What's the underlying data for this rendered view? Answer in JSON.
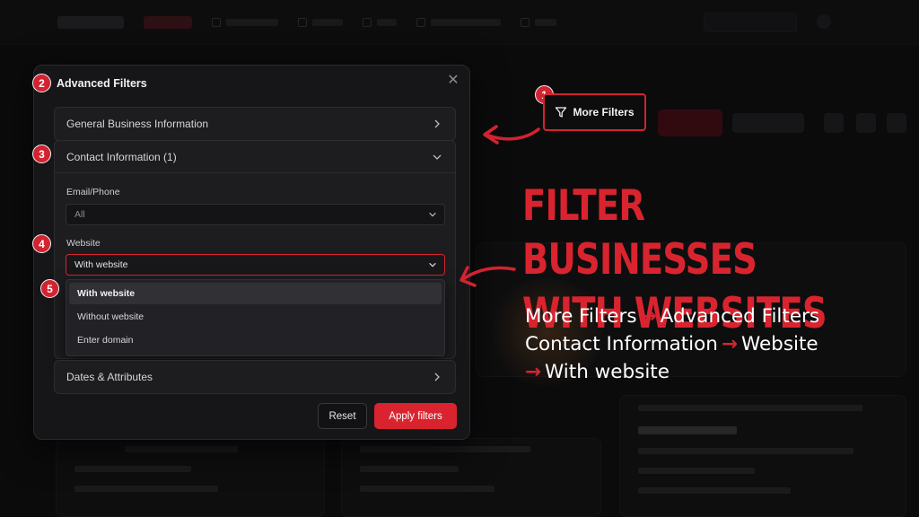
{
  "modal": {
    "title": "Advanced Filters",
    "close_icon": "close-icon",
    "sections": [
      {
        "label": "General Business Information",
        "state": "collapsed"
      },
      {
        "label": "Contact Information (1)",
        "state": "expanded"
      },
      {
        "label": "Dates & Attributes",
        "state": "collapsed"
      }
    ],
    "email_phone": {
      "label": "Email/Phone",
      "value": "All"
    },
    "website": {
      "label": "Website",
      "value": "With website",
      "options": [
        "With website",
        "Without website",
        "Enter domain"
      ],
      "selected_index": 0
    },
    "reset_label": "Reset",
    "apply_label": "Apply filters"
  },
  "more_filters": {
    "label": "More Filters",
    "icon": "filter-icon"
  },
  "badges": [
    "1",
    "2",
    "3",
    "4",
    "5"
  ],
  "headline": {
    "line1": "Filter Businesses",
    "line2": "With Websites"
  },
  "steps": {
    "s1": "More Filters",
    "s2": "Advanced Filters",
    "s3": "Contact Information",
    "s4": "Website",
    "s5": "With website",
    "arrow": "→"
  },
  "colors": {
    "accent": "#d9242f",
    "panel": "#161618",
    "background": "#0b0b0c"
  }
}
